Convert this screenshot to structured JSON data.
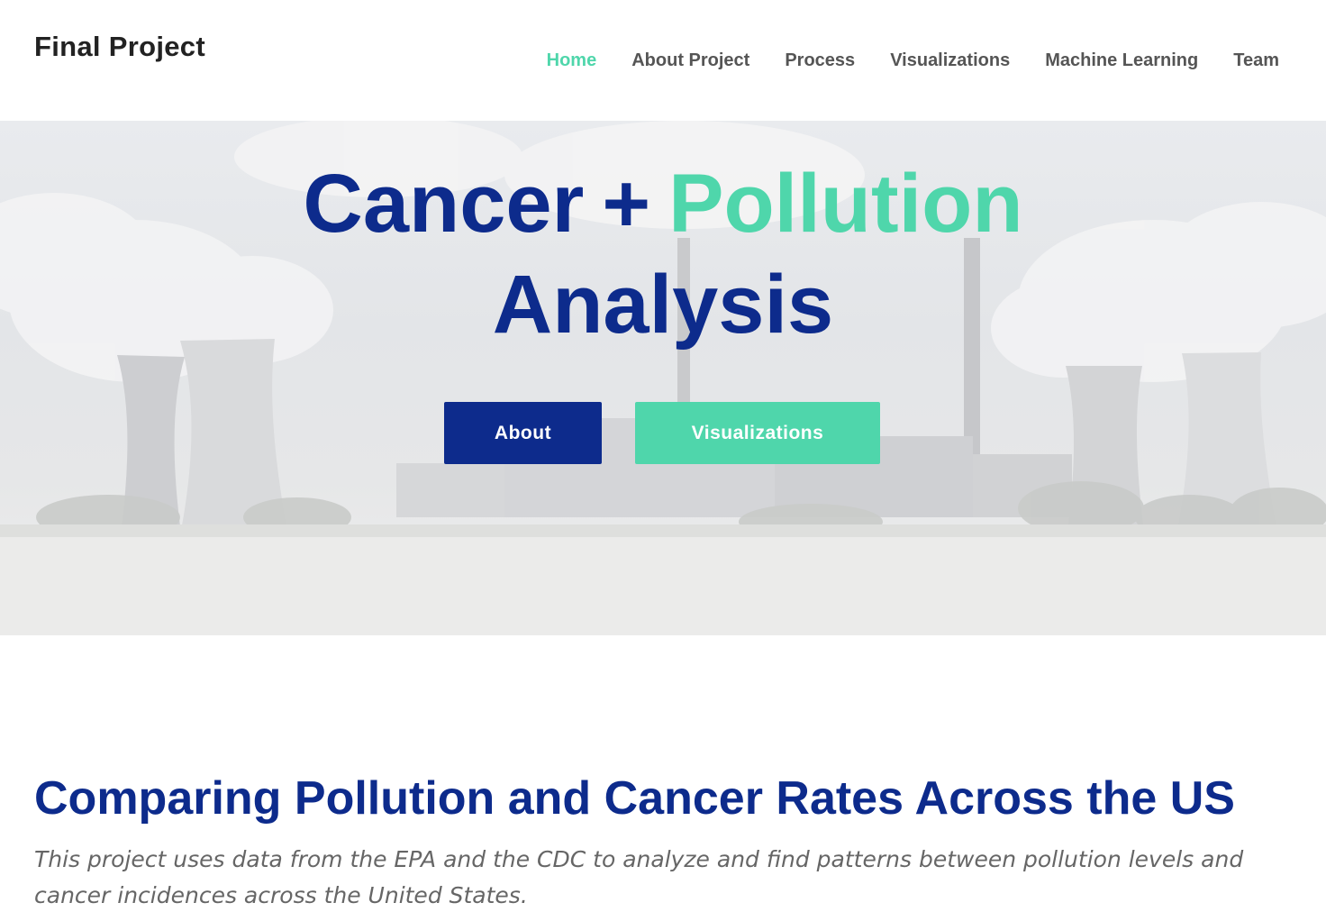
{
  "header": {
    "brand": "Final Project",
    "nav": [
      {
        "label": "Home",
        "active": true
      },
      {
        "label": "About Project",
        "active": false
      },
      {
        "label": "Process",
        "active": false
      },
      {
        "label": "Visualizations",
        "active": false
      },
      {
        "label": "Machine Learning",
        "active": false
      },
      {
        "label": "Team",
        "active": false
      }
    ]
  },
  "hero": {
    "title_part1": "Cancer",
    "title_plus": "+",
    "title_part2": "Pollution",
    "title_line2": "Analysis",
    "buttons": {
      "about": "About",
      "visualizations": "Visualizations"
    }
  },
  "content": {
    "heading": "Comparing Pollution and Cancer Rates Across the US",
    "description": "This project uses data from the EPA and the CDC to analyze and find patterns between pollution levels and cancer incidences across the United States."
  },
  "colors": {
    "primary": "#0d2b8c",
    "accent": "#4fd6ab",
    "nav_text": "#555555"
  }
}
